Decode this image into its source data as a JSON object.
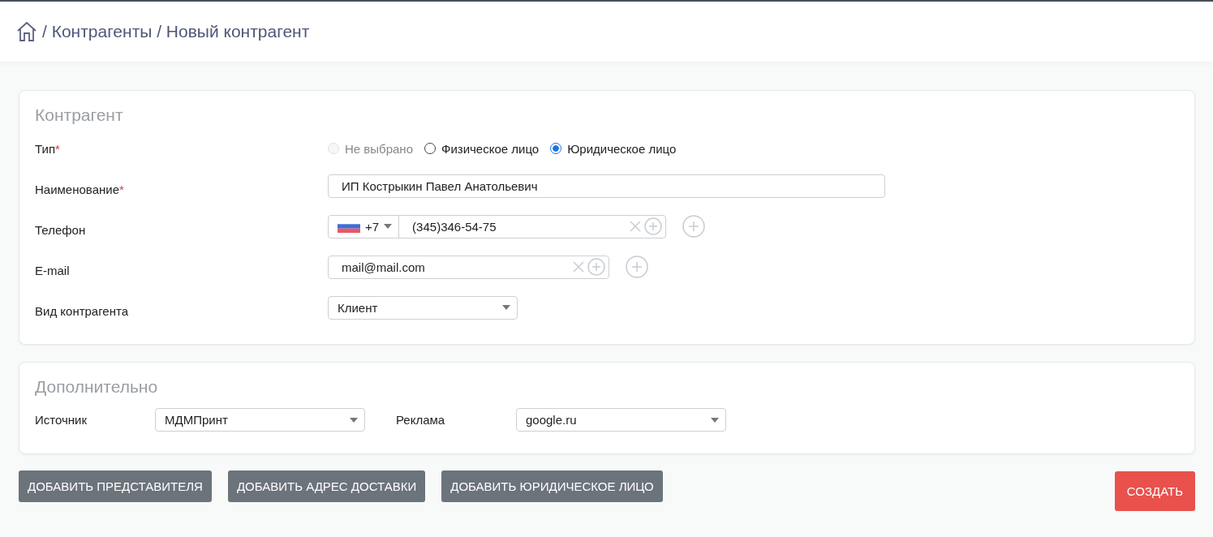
{
  "breadcrumb": [
    "/ Контрагенты / Новый контрагент"
  ],
  "main_card": {
    "title": "Контрагент",
    "rows": [
      {
        "kind": "radio",
        "label": "Тип",
        "required_mark": "*",
        "options": [
          {
            "label": "Не выбрано",
            "selected": false,
            "disabled": true
          },
          {
            "label": "Физическое лицо",
            "selected": false,
            "disabled": false
          },
          {
            "label": "Юридическое лицо",
            "selected": true,
            "disabled": false
          }
        ]
      },
      {
        "kind": "text",
        "label": "Наименование",
        "required_mark": "*",
        "value": "ИП Кострыкин Павел Анатольевич"
      },
      {
        "kind": "phone",
        "label": "Телефон",
        "country_code": "+7",
        "value": "(345)346-54-75"
      },
      {
        "kind": "email",
        "label": "E-mail",
        "value": "mail@mail.com"
      },
      {
        "kind": "select",
        "label": "Вид контрагента",
        "value": "Клиент"
      }
    ]
  },
  "extra_card": {
    "title": "Дополнительно",
    "fields": [
      {
        "label": "Источник",
        "value": "МДМПринт"
      },
      {
        "label": "Реклама",
        "value": "google.ru"
      }
    ]
  },
  "buttons": [
    {
      "label": "ДОБАВИТЬ ПРЕДСТАВИТЕЛЯ",
      "kind": "secondary"
    },
    {
      "label": "ДОБАВИТЬ АДРЕС ДОСТАВКИ",
      "kind": "secondary"
    },
    {
      "label": "ДОБАВИТЬ ЮРИДИЧЕСКОЕ ЛИЦО",
      "kind": "secondary"
    },
    {
      "label": "СОЗДАТЬ",
      "kind": "primary"
    }
  ]
}
